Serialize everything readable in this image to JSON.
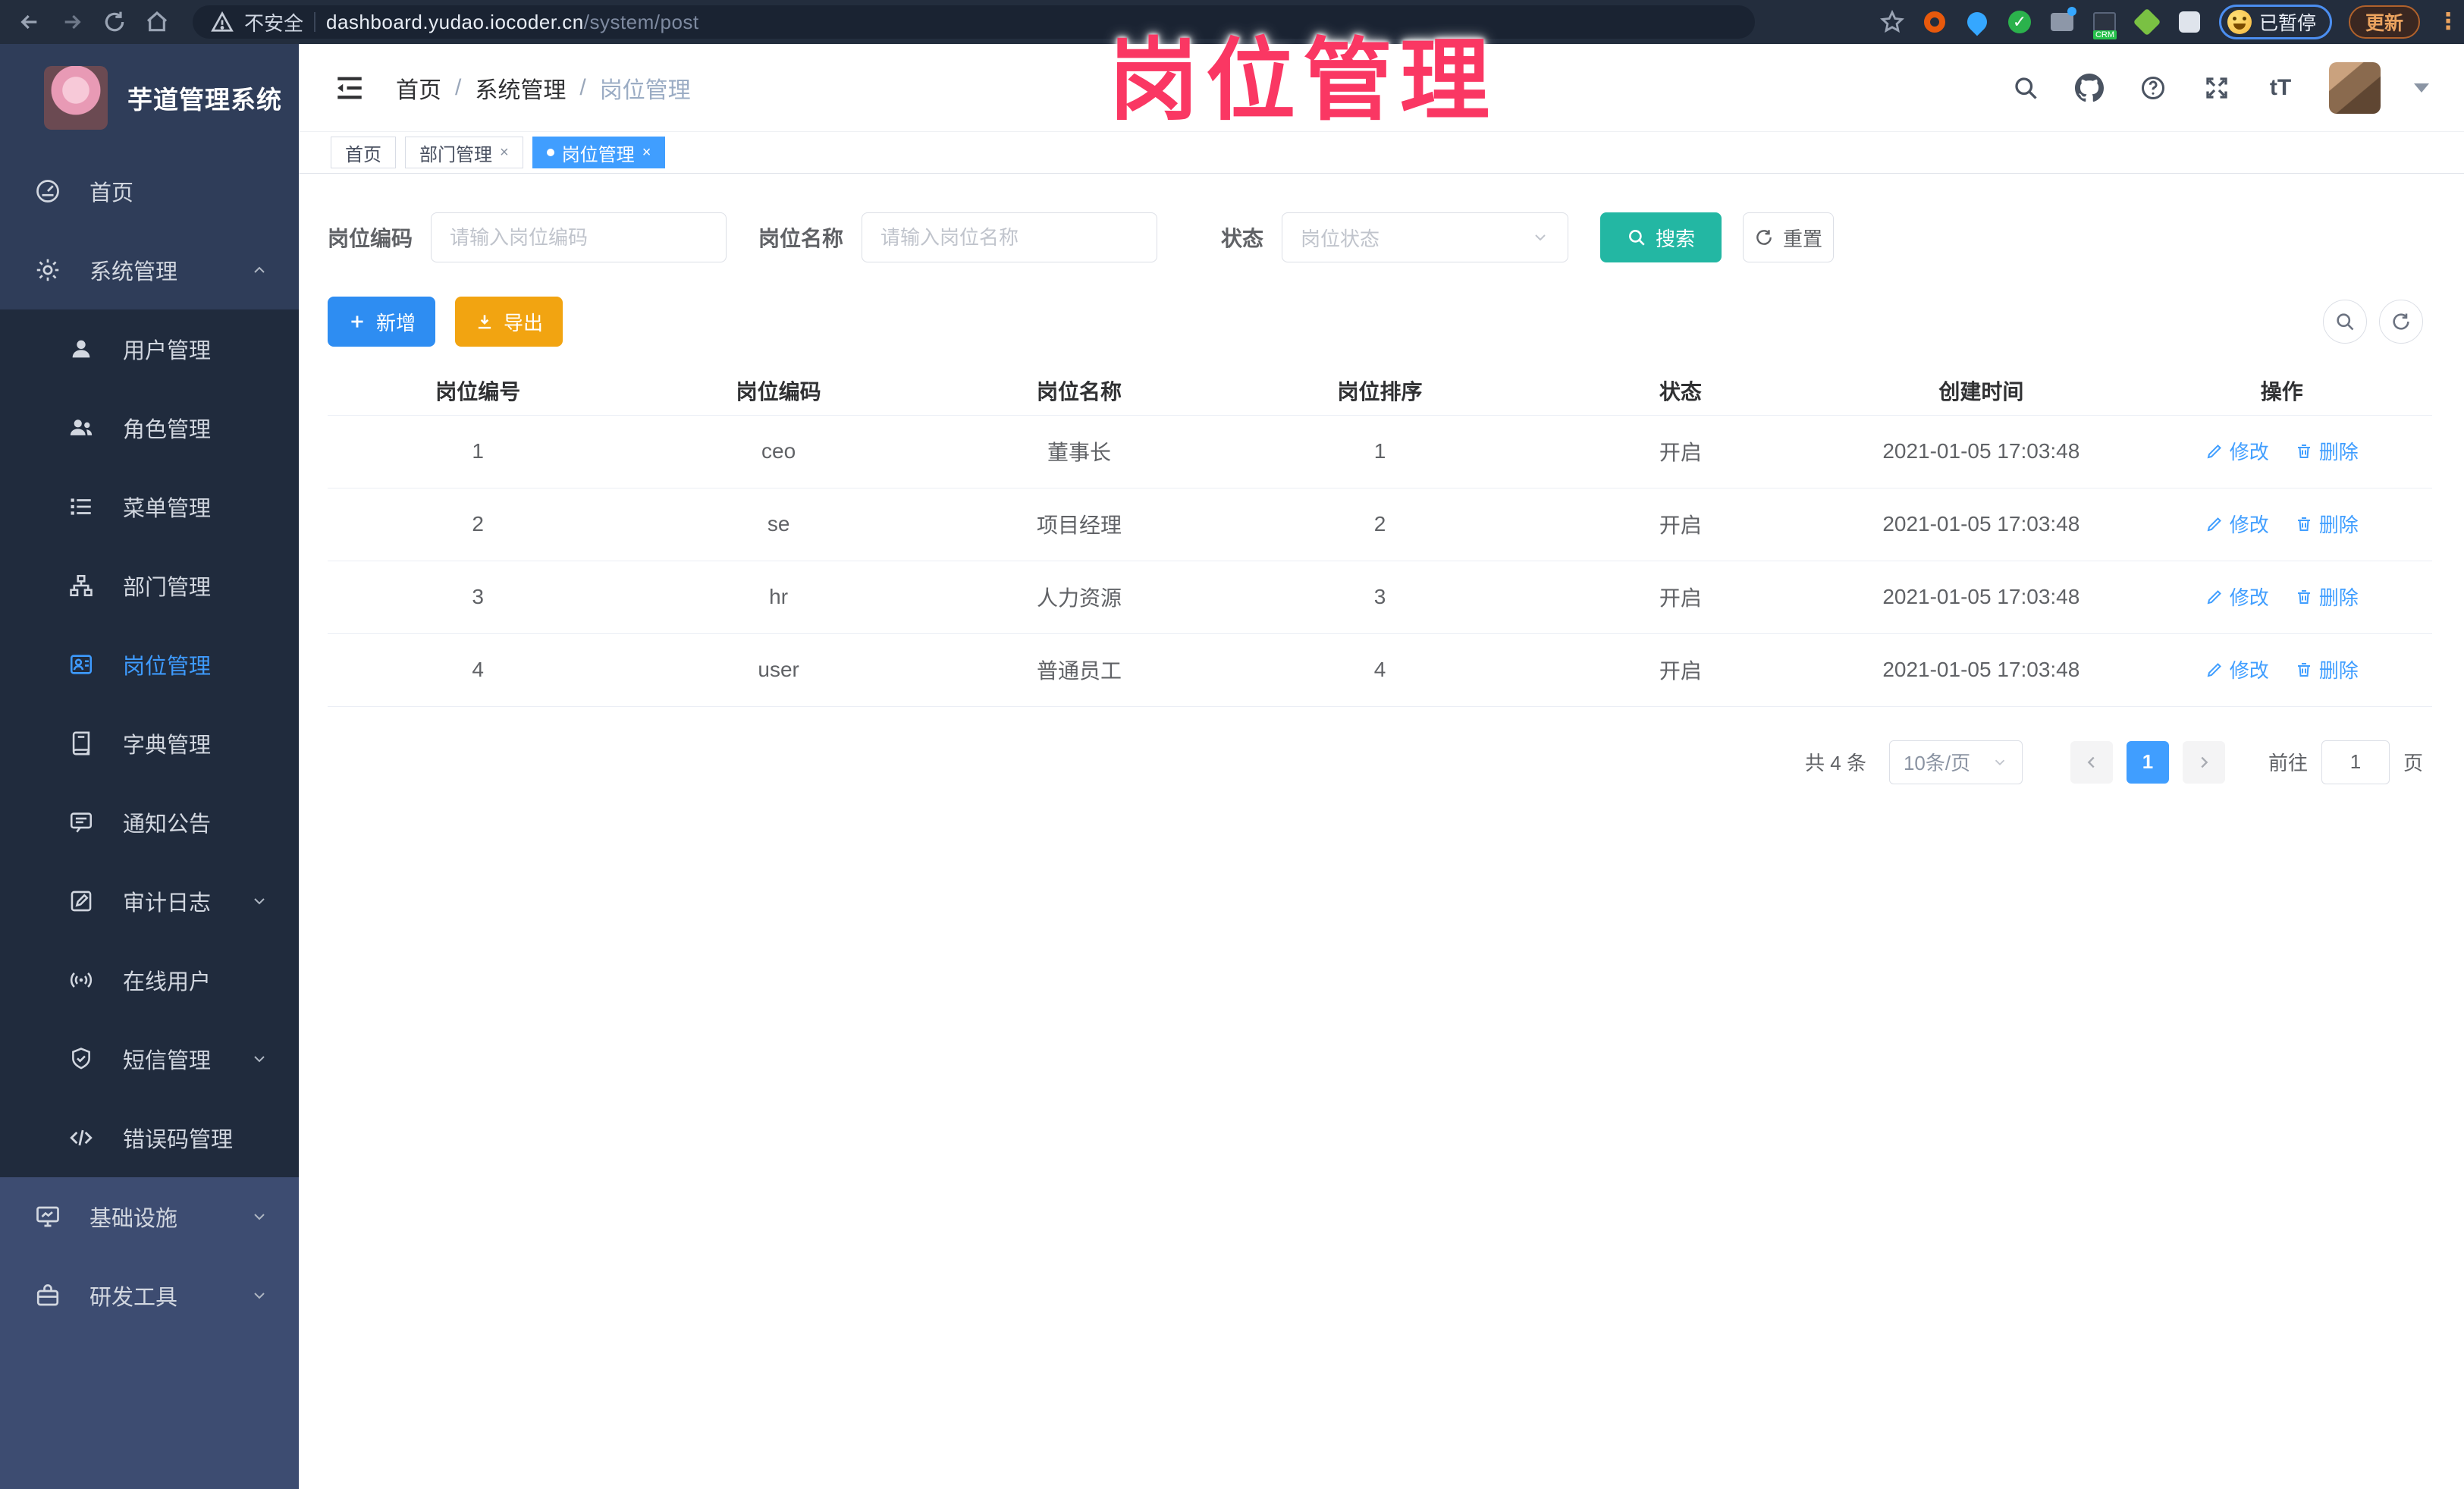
{
  "browser": {
    "security_label": "不安全",
    "url_host": "dashboard.yudao.iocoder.cn",
    "url_path": "/system/post",
    "profile_chip_label": "已暂停",
    "update_button_label": "更新"
  },
  "overlay": {
    "title": "岗位管理",
    "color": "#fa3763"
  },
  "sidebar": {
    "app_title": "芋道管理系统",
    "items": [
      {
        "label": "首页",
        "icon": "dashboard-icon",
        "level": "top"
      },
      {
        "label": "系统管理",
        "icon": "gear-icon",
        "level": "top",
        "expanded": true
      },
      {
        "label": "用户管理",
        "icon": "user-icon",
        "level": "sub"
      },
      {
        "label": "角色管理",
        "icon": "role-icon",
        "level": "sub"
      },
      {
        "label": "菜单管理",
        "icon": "menu-list-icon",
        "level": "sub"
      },
      {
        "label": "部门管理",
        "icon": "org-tree-icon",
        "level": "sub"
      },
      {
        "label": "岗位管理",
        "icon": "post-badge-icon",
        "level": "sub",
        "active": true
      },
      {
        "label": "字典管理",
        "icon": "dict-book-icon",
        "level": "sub"
      },
      {
        "label": "通知公告",
        "icon": "notice-icon",
        "level": "sub"
      },
      {
        "label": "审计日志",
        "icon": "audit-log-icon",
        "level": "sub",
        "collapsed": true
      },
      {
        "label": "在线用户",
        "icon": "online-signal-icon",
        "level": "sub"
      },
      {
        "label": "短信管理",
        "icon": "sms-shield-icon",
        "level": "sub",
        "collapsed": true
      },
      {
        "label": "错误码管理",
        "icon": "error-code-icon",
        "level": "sub"
      },
      {
        "label": "基础设施",
        "icon": "infra-monitor-icon",
        "level": "top",
        "collapsed": true
      },
      {
        "label": "研发工具",
        "icon": "devtools-icon",
        "level": "top",
        "collapsed": true
      }
    ]
  },
  "header": {
    "breadcrumb": [
      "首页",
      "系统管理",
      "岗位管理"
    ],
    "font_icon_text": "tT"
  },
  "tabs": [
    {
      "label": "首页",
      "closable": false,
      "active": false
    },
    {
      "label": "部门管理",
      "closable": true,
      "active": false
    },
    {
      "label": "岗位管理",
      "closable": true,
      "active": true
    }
  ],
  "filters": {
    "code_label": "岗位编码",
    "code_placeholder": "请输入岗位编码",
    "name_label": "岗位名称",
    "name_placeholder": "请输入岗位名称",
    "status_label": "状态",
    "status_placeholder": "岗位状态",
    "search_label": "搜索",
    "reset_label": "重置"
  },
  "toolbar": {
    "add_label": "新增",
    "export_label": "导出"
  },
  "table": {
    "columns": [
      "岗位编号",
      "岗位编码",
      "岗位名称",
      "岗位排序",
      "状态",
      "创建时间",
      "操作"
    ],
    "edit_label": "修改",
    "delete_label": "删除",
    "rows": [
      {
        "id": "1",
        "code": "ceo",
        "name": "董事长",
        "sort": "1",
        "status": "开启",
        "created": "2021-01-05 17:03:48"
      },
      {
        "id": "2",
        "code": "se",
        "name": "项目经理",
        "sort": "2",
        "status": "开启",
        "created": "2021-01-05 17:03:48"
      },
      {
        "id": "3",
        "code": "hr",
        "name": "人力资源",
        "sort": "3",
        "status": "开启",
        "created": "2021-01-05 17:03:48"
      },
      {
        "id": "4",
        "code": "user",
        "name": "普通员工",
        "sort": "4",
        "status": "开启",
        "created": "2021-01-05 17:03:48"
      }
    ]
  },
  "pagination": {
    "total_text": "共 4 条",
    "page_size": "10条/页",
    "current_page": "1",
    "goto_label": "前往",
    "goto_value": "1",
    "page_unit": "页"
  },
  "colors": {
    "accent_blue": "#409eff",
    "search_teal": "#23b7a3",
    "export_orange": "#f2a411",
    "sidebar_bg": "#2f3d59",
    "submenu_bg": "#202b3d"
  }
}
